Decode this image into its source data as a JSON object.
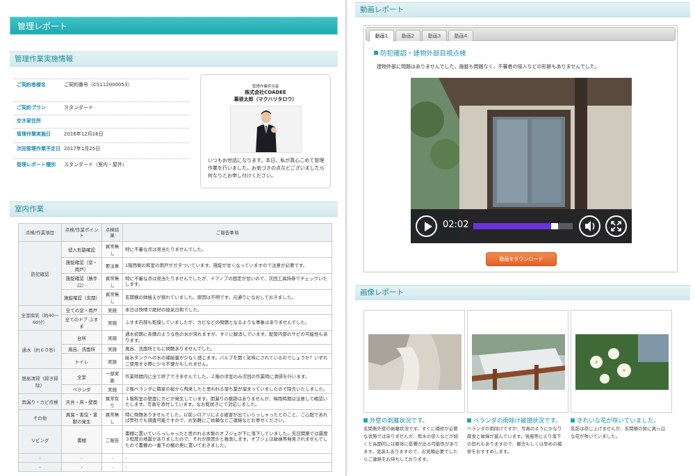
{
  "left": {
    "main_title": "管理レポート",
    "info_section_title": "管理作業実施情報",
    "info_rows": [
      {
        "label": "ご契約者様名",
        "value": "ご契約番号（CS112000053）"
      },
      {
        "label": "ご契約プラン",
        "value": "スタンダード"
      },
      {
        "label": "空き家住所",
        "value": ""
      },
      {
        "label": "管理作業実施日",
        "value": "2016年12月16日"
      },
      {
        "label": "次回管理作業予定日",
        "value": "2017年1月25日"
      },
      {
        "label": "管理レポート種別",
        "value": "スタンダード（室内・屋外）"
      }
    ],
    "operator": {
      "role": "管理作業担当者",
      "company": "株式会社COADEE",
      "person": "幕張太郎（マクハリタロウ）",
      "message": "いつもお世話になります。本日、私が真心こめて管理作業を行いました。お気づきの点などございましたら何なりとお申し付けください。"
    },
    "indoor_section_title": "室内作業",
    "table": {
      "headers": [
        "点検/作業項目",
        "点検/作業ポイント",
        "点検結果",
        "ご報告事項"
      ],
      "groups": [
        {
          "name": "防犯確認",
          "rows": [
            {
              "point": "侵入形跡確認",
              "result": "異常無し",
              "note": "特に不審な点は見当たりませんでした。"
            },
            {
              "point": "施錠確認（窓・雨戸）",
              "result": "要注意",
              "note": "1階西側の和室の雨戸がガタついています。施錠が甘くなっていますので注意が必要です。"
            },
            {
              "point": "施錠確認（勝手口）",
              "result": "異常無し",
              "note": "特に不審な点は見当たりませんでしたが、ドアノブの固定が甘いので、次回工具持参でチェックいたします。"
            },
            {
              "point": "施錠確認（玄関）",
              "result": "異常無し",
              "note": "玄関横の鉢植えが倒れていました。原因は不明です。元通りになおしておきました。"
            }
          ]
        },
        {
          "name": "全室換気（約40〜60分）",
          "rows": [
            {
              "point": "全ての窓・雨戸",
              "result": "実施",
              "note": "本日は快晴で絶好の換気日和でした。"
            },
            {
              "point": "全てのドア ふすま",
              "result": "実施",
              "note": "ふすま内部も乾燥していましたが、カビなどの問題となるような事象はありませんでした。"
            }
          ]
        },
        {
          "name": "通水（約６０秒）",
          "rows": [
            {
              "point": "台所",
              "result": "実施",
              "note": "通水初期に赤錆のような色の水が流れますが、すぐに解消しています。配管内部のサビの可能性もあります。"
            },
            {
              "point": "風呂、洗面所",
              "result": "実施",
              "note": "風呂、洗面所ともに問題ありませんでした。"
            },
            {
              "point": "トイレ",
              "result": "実施",
              "note": "給水タンクへの水の補給量が少なく感じます。バルブを開く気味にされているのでしょうか？いずれご使用する際に少々不便かもしれません。"
            }
          ]
        },
        {
          "name": "簡易清掃（掃き掃除）",
          "rows": [
            {
              "point": "全室",
              "result": "一部実施",
              "note": "作業時間内に全て終了できませんでした。２階の洋室のみ次回の作業時に清掃を行います。"
            },
            {
              "point": "ベランダ",
              "result": "実施",
              "note": "２階ベランダに隣家の桜から飛来したと思われる落ち葉が溜まっていましたので除去いたしました。"
            }
          ]
        },
        {
          "name": "雨漏り・カビ点検",
          "rows": [
            {
              "point": "天井・床・壁面",
              "result": "異常有り",
              "note": "１階和室の壁面にカビが発生しています。雨漏りの痕跡はありませんが、梅雨時期は注意して確認いたします。写真を添付しています。なお乾拭きにて対応しました。"
            }
          ]
        },
        {
          "name": "その他",
          "rows": [
            {
              "point": "異臭・害虫・害獣の発生",
              "result": "異常無し",
              "note": "特に問題ありませんでした。以前シロアリによる被害が出ていらっしゃったとのこと、ご心配であれば弊社でも調査可能ですので、お気軽にご依頼などご連絡などお寄せください。"
            }
          ]
        },
        {
          "name": "リビング",
          "rows": [
            {
              "point": "書棚",
              "result": "ご報告",
              "note": "書棚に置いていらっしゃったと思われる木製のオブジェが下に落下していました。先日関東では震度３程度の地震がありましたので、それが原因かと推測します。オブジェは破損等発見されませんでしたので書棚の一番下の棚の奥に置いておきました。"
            }
          ]
        },
        {
          "name": "-",
          "rows": [
            {
              "point": "-",
              "result": "-",
              "note": "-"
            }
          ]
        },
        {
          "name": "-",
          "rows": [
            {
              "point": "-",
              "result": "-",
              "note": "-"
            }
          ]
        }
      ]
    }
  },
  "right": {
    "video_section_title": "動画レポート",
    "tabs": [
      "動画1",
      "動画2",
      "動画3",
      "動画4"
    ],
    "active_tab": 0,
    "video_title": "防犯確認・建物外部目視点検",
    "video_desc": "建物外部に問題はありませんでした。施錠も問題なく、不審者の侵入などの形跡もありませんでした。",
    "player": {
      "time": "02:02",
      "progress": 0.82
    },
    "download_label": "動画をダウンロード",
    "image_section_title": "画像レポート",
    "images": [
      {
        "title": "外壁の剥離状況です。",
        "text": "玄関側外壁の剥離状況です。すぐに補修が必要な状態ではありませんが、雨水の侵入などが続くと長期的には躯体に影響が出る可能性があります。塗装もありますので、お見積必要でしたらご連絡をお待ちしております。"
      },
      {
        "title": "ベランダの雨除け破損状況です。",
        "text": "ベランダの雨除けですが、写真のようにかなり腐食と破損が進んでいます。強風等により落下の恐れもありますので、撤去もしくは早めの補修をおすすめします。"
      },
      {
        "title": "きれいな花が咲いていました。",
        "text": "名前は存じ上げませんが、玄関横の鉢に真っ白な花が咲いていました。"
      }
    ],
    "colors": {
      "accent": "#22a7b0",
      "link": "#1a8fb0",
      "progress": "#6a35d8",
      "download": "#e2622a"
    }
  }
}
